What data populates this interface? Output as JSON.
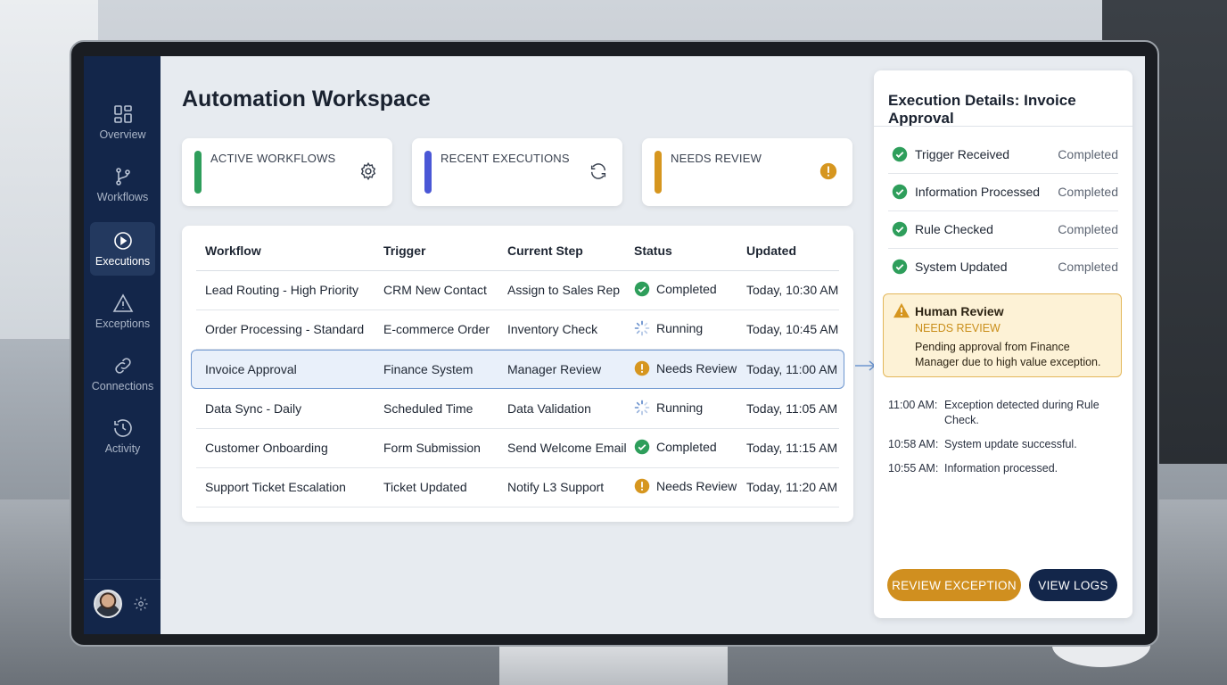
{
  "app": {
    "title": "Automation Workspace"
  },
  "sidebar": {
    "items": [
      {
        "label": "Overview",
        "icon": "dashboard-icon"
      },
      {
        "label": "Workflows",
        "icon": "branch-icon"
      },
      {
        "label": "Executions",
        "icon": "play-circle-icon",
        "active": true
      },
      {
        "label": "Exceptions",
        "icon": "warning-triangle-icon"
      },
      {
        "label": "Connections",
        "icon": "link-icon"
      },
      {
        "label": "Activity",
        "icon": "history-icon"
      }
    ],
    "footer": {
      "avatar": "user-avatar",
      "settings_icon": "gear-icon"
    }
  },
  "stats": [
    {
      "label": "ACTIVE WORKFLOWS",
      "color": "#2e9e5b",
      "icon": "gear-icon"
    },
    {
      "label": "RECENT EXECUTIONS",
      "color": "#4a57d6",
      "icon": "refresh-icon"
    },
    {
      "label": "NEEDS REVIEW",
      "color": "#d6961f",
      "icon": "alert-icon"
    }
  ],
  "table": {
    "columns": [
      "Workflow",
      "Trigger",
      "Current Step",
      "Status",
      "Updated"
    ],
    "rows": [
      {
        "workflow": "Lead Routing - High Priority",
        "trigger": "CRM New Contact",
        "step": "Assign to Sales Rep",
        "status": "Completed",
        "updated": "Today, 10:30 AM"
      },
      {
        "workflow": "Order Processing - Standard",
        "trigger": "E-commerce Order",
        "step": "Inventory Check",
        "status": "Running",
        "updated": "Today, 10:45 AM"
      },
      {
        "workflow": "Invoice Approval",
        "trigger": "Finance System",
        "step": "Manager Review",
        "status": "Needs Review",
        "updated": "Today, 11:00 AM",
        "selected": true
      },
      {
        "workflow": "Data Sync - Daily",
        "trigger": "Scheduled Time",
        "step": "Data Validation",
        "status": "Running",
        "updated": "Today, 11:05 AM"
      },
      {
        "workflow": "Customer Onboarding",
        "trigger": "Form Submission",
        "step": "Send Welcome Email",
        "status": "Completed",
        "updated": "Today, 11:15 AM"
      },
      {
        "workflow": "Support Ticket Escalation",
        "trigger": "Ticket Updated",
        "step": "Notify L3 Support",
        "status": "Needs Review",
        "updated": "Today, 11:20 AM"
      }
    ]
  },
  "details": {
    "title": "Execution Details: Invoice Approval",
    "steps": [
      {
        "name": "Trigger Received",
        "status": "Completed"
      },
      {
        "name": "Information Processed",
        "status": "Completed"
      },
      {
        "name": "Rule Checked",
        "status": "Completed"
      },
      {
        "name": "System Updated",
        "status": "Completed"
      }
    ],
    "review": {
      "title": "Human Review",
      "subtitle": "NEEDS REVIEW",
      "text": "Pending approval from Finance Manager due to high value exception."
    },
    "log": [
      {
        "time": "11:00 AM:",
        "message": "Exception detected during Rule Check."
      },
      {
        "time": "10:58 AM:",
        "message": "System update successful."
      },
      {
        "time": "10:55 AM:",
        "message": "Information processed."
      }
    ],
    "buttons": {
      "review_exception": "REVIEW EXCEPTION",
      "view_logs": "VIEW LOGS"
    }
  },
  "colors": {
    "sidebar": "#13264a",
    "completed": "#2e9e5b",
    "needs_review": "#d6961f",
    "running": "#5b86c8",
    "accent_button": "#d08f1f"
  }
}
